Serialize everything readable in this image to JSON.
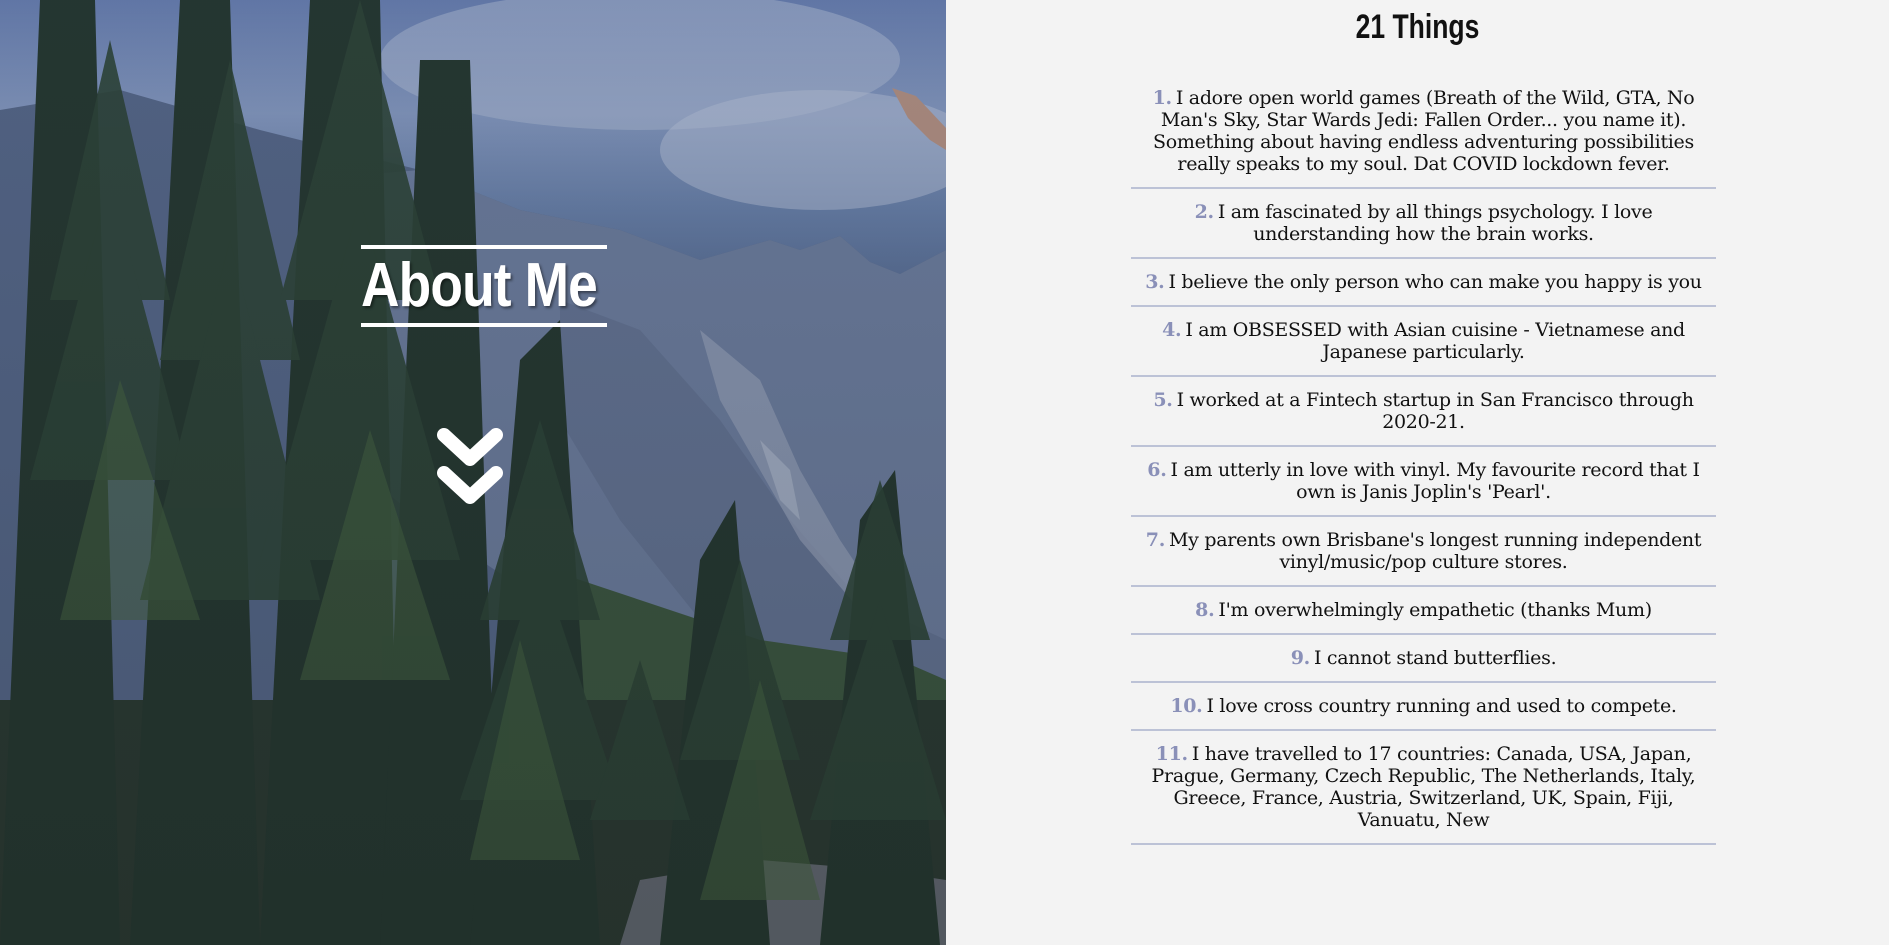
{
  "hero": {
    "title": "About Me",
    "scroll_icon": "double-chevron-down-icon"
  },
  "panel": {
    "title": "21 Things"
  },
  "items": [
    {
      "num": "1.",
      "text": "I adore open world games (Breath of the Wild, GTA, No Man's Sky, Star Wards Jedi: Fallen Order... you name it). Something about having endless adventuring possibilities really speaks to my soul. Dat COVID lockdown fever."
    },
    {
      "num": "2.",
      "text": "I am fascinated by all things psychology. I love understanding how the brain works."
    },
    {
      "num": "3.",
      "text": "I believe the only person who can make you happy is you"
    },
    {
      "num": "4.",
      "text": "I am OBSESSED with Asian cuisine - Vietnamese and Japanese particularly."
    },
    {
      "num": "5.",
      "text": "I worked at a Fintech startup in San Francisco through 2020-21."
    },
    {
      "num": "6.",
      "text": "I am utterly in love with vinyl. My favourite record that I own is Janis Joplin's 'Pearl'."
    },
    {
      "num": "7.",
      "text": "My parents own Brisbane's longest running independent vinyl/music/pop culture stores."
    },
    {
      "num": "8.",
      "text": "I'm overwhelmingly empathetic (thanks Mum)"
    },
    {
      "num": "9.",
      "text": "I cannot stand butterflies."
    },
    {
      "num": "10.",
      "text": "I love cross country running and used to compete."
    },
    {
      "num": "11.",
      "text": "I have travelled to 17 countries: Canada, USA, Japan, Prague, Germany, Czech Republic, The Netherlands, Italy, Greece, France, Austria, Switzerland, UK, Spain, Fiji, Vanuatu, New"
    }
  ],
  "colors": {
    "accent_number": "#8a90b8",
    "divider": "#bcc2d6",
    "panel_bg": "#f3f3f3"
  }
}
